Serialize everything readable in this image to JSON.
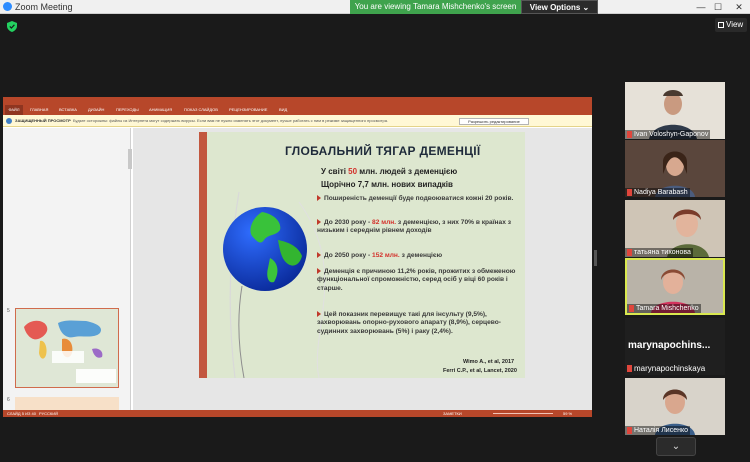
{
  "window": {
    "title": "Zoom Meeting",
    "share_banner": "You are viewing Tamara Mishchenko's screen",
    "view_options": "View Options",
    "view_button": "View",
    "minimize": "—",
    "maximize": "☐",
    "close": "✕"
  },
  "ppt": {
    "file_tab": "ФАЙЛ",
    "ribbon_tabs": [
      "ГЛАВНАЯ",
      "ВСТАВКА",
      "ДИЗАЙН",
      "ПЕРЕХОДЫ",
      "АНИМАЦИЯ",
      "ПОКАЗ СЛАЙДОВ",
      "РЕЦЕНЗИРОВАНИЕ",
      "ВИД"
    ],
    "protected_label": "ЗАЩИЩЕННЫЙ ПРОСМОТР",
    "protected_text": "Будьте осторожны: файлы из Интернета могут содержать вирусы. Если вам не нужно изменять этот документ, лучше работать с ним в режиме защищенного просмотра.",
    "enable_editing": "Разрешить редактирование",
    "thumb_num_1": "5",
    "thumb_num_2": "6",
    "status_left": "СЛАЙД 5 ИЗ 40",
    "status_lang": "РУССКИЙ",
    "status_notes": "ЗАМЕТКИ",
    "status_zoom": "59 %"
  },
  "slide": {
    "title": "ГЛОБАЛЬНИЙ ТЯГАР ДЕМЕНЦІЇ",
    "line1_pre": "У світі ",
    "line1_num": "50",
    "line1_post": " млн. людей з деменцією",
    "line2": "Щорічно 7,7 млн. нових випадків",
    "bullets": [
      {
        "pre": "Поширеність деменції буде подвоюватися кожні 20 років.",
        "num": "",
        "post": ""
      },
      {
        "pre": "До 2030 року - ",
        "num": "82 млн.",
        "post": " з деменцією, з них 70% в країнах з низьким і середнім рівнем доходів"
      },
      {
        "pre": "До 2050 року - ",
        "num": "152 млн.",
        "post": " з деменцією"
      },
      {
        "pre": "Деменція є причиною 11,2% років, прожитих з обмеженою функціональної спроможністю, серед осіб у віці 60 років і старше.",
        "num": "",
        "post": ""
      },
      {
        "pre": "Цей показник перевищує такі для інсульту (9,5%), захворювань опорно-рухового апарату (8,9%), серцево-судинних захворювань (5%) і раку (2,4%).",
        "num": "",
        "post": ""
      }
    ],
    "cite1": "Wimo A., et al, 2017",
    "cite2": "Ferri C.P., et al, Lancet, 2020"
  },
  "participants": [
    {
      "name": "Ivan Voloshyn-Gaponov"
    },
    {
      "name": "Nadiya Barabash"
    },
    {
      "name": "татьяна тихонова"
    },
    {
      "name": "Tamara Mishchenko"
    },
    {
      "name": "marynapochins...",
      "sub": "marynapochinskaya"
    },
    {
      "name": "Наталія Лисенко"
    }
  ],
  "colors": {
    "ppt_red": "#b7472a",
    "zoom_green": "#3fa34d",
    "active_speaker": "#d9e84f"
  }
}
